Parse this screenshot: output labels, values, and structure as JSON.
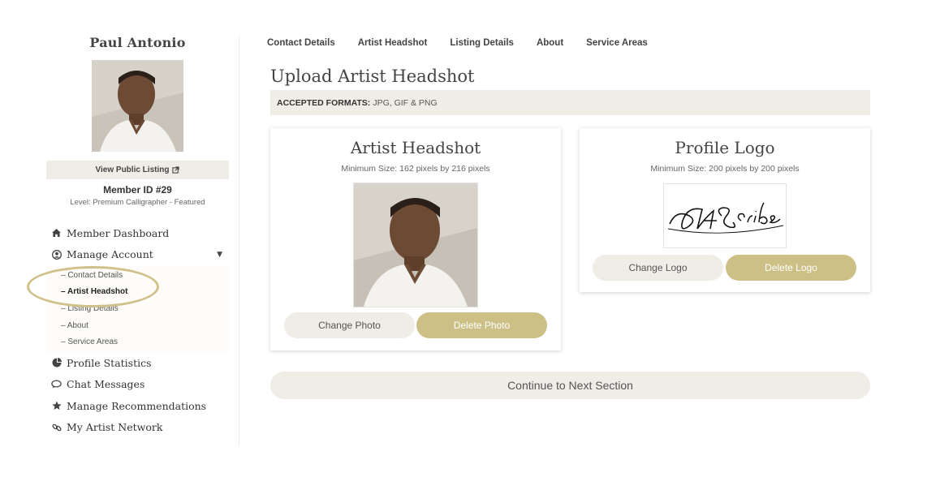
{
  "sidebar": {
    "name": "Paul Antonio",
    "avatar_icon": "person-photo",
    "view_listing_label": "View Public Listing",
    "member_id": "Member ID #29",
    "level": "Level: Premium Calligrapher - Featured",
    "nav": [
      {
        "label": "Member Dashboard",
        "icon": "home-icon"
      },
      {
        "label": "Manage Account",
        "icon": "user-circle-icon"
      },
      {
        "label": "Profile Statistics",
        "icon": "pie-chart-icon"
      },
      {
        "label": "Chat Messages",
        "icon": "chat-icon"
      },
      {
        "label": "Manage Recommendations",
        "icon": "star-icon"
      },
      {
        "label": "My Artist Network",
        "icon": "link-icon"
      }
    ],
    "subnav": [
      {
        "label": "– Contact Details"
      },
      {
        "label": "– Artist Headshot"
      },
      {
        "label": "– Listing Details"
      },
      {
        "label": "– About"
      },
      {
        "label": "– Service Areas"
      }
    ]
  },
  "tabs": [
    "Contact Details",
    "Artist Headshot",
    "Listing Details",
    "About",
    "Service Areas"
  ],
  "page_title": "Upload Artist Headshot",
  "formats": {
    "label": "ACCEPTED FORMATS:",
    "value": "JPG, GIF & PNG"
  },
  "headshot_card": {
    "title": "Artist Headshot",
    "subtitle": "Minimum Size: 162 pixels by 216 pixels",
    "change_label": "Change Photo",
    "delete_label": "Delete Photo"
  },
  "logo_card": {
    "title": "Profile Logo",
    "subtitle": "Minimum Size: 200 pixels by 200 pixels",
    "logo_text": "PAScribe",
    "change_label": "Change Logo",
    "delete_label": "Delete Logo"
  },
  "continue_label": "Continue to Next Section",
  "colors": {
    "accent_gold": "#cdc086",
    "light_bg": "#f0ede6",
    "highlight_ring": "#cfc189"
  }
}
